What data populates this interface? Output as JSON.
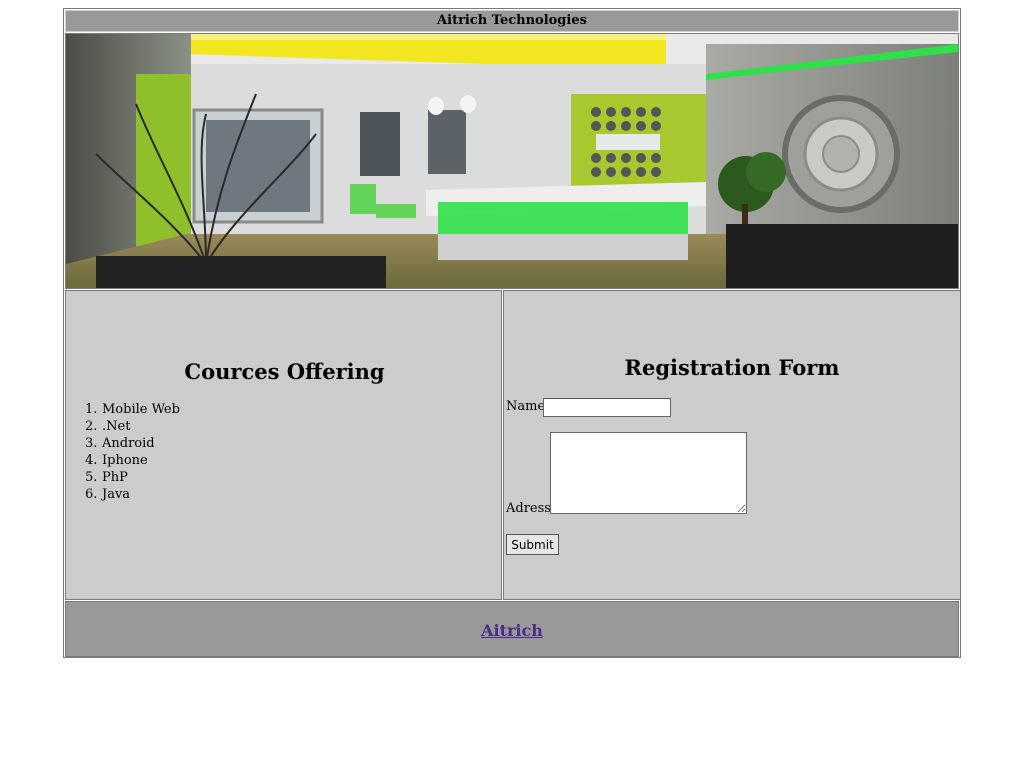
{
  "header": {
    "title": "Aitrich Technologies"
  },
  "banner": {
    "image_name": "office-reception-photo",
    "colors": {
      "accent_green": "#2fe04a",
      "ceiling_yellow": "#f2e620",
      "wall_green": "#a8c830"
    }
  },
  "courses": {
    "title": "Cources Offering",
    "items": [
      {
        "num": "1.",
        "label": "Mobile Web"
      },
      {
        "num": "2.",
        "label": ".Net"
      },
      {
        "num": "3.",
        "label": "Android"
      },
      {
        "num": "4.",
        "label": "Iphone"
      },
      {
        "num": "5.",
        "label": "PhP"
      },
      {
        "num": "6.",
        "label": "Java"
      }
    ]
  },
  "form": {
    "title": "Registration Form",
    "name_label": "Name",
    "name_value": "",
    "adress_label": "Adress",
    "adress_value": "",
    "submit_label": "Submit"
  },
  "footer": {
    "link_label": "Aitrich",
    "link_color": "#4b2a8c"
  },
  "colors": {
    "header_bg": "#999999",
    "panel_bg": "#cccccc",
    "border": "#7a7a7a"
  }
}
